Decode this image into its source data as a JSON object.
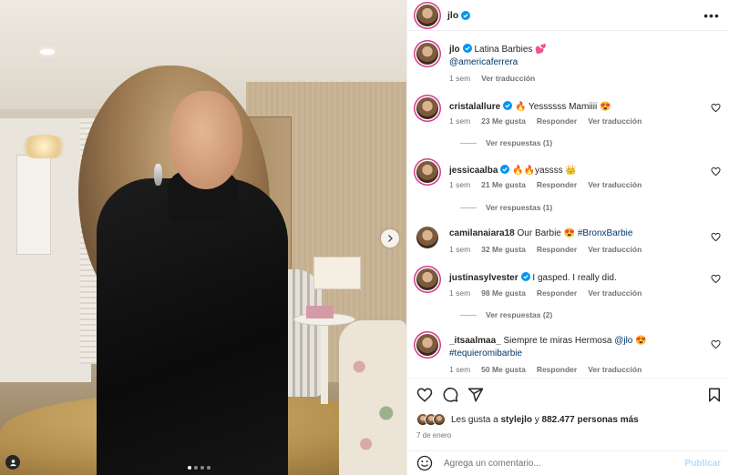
{
  "post": {
    "author": "jlo",
    "caption_text": "Latina Barbies 💕",
    "caption_mention": "@americaferrera",
    "caption_time": "1 sem",
    "caption_translate": "Ver traducción",
    "carousel": {
      "total_slides": 4,
      "current_slide": 1
    }
  },
  "comments": [
    {
      "user": "cristalallure",
      "verified": true,
      "text": "🔥 Yessssss Mamiiii 😍",
      "time": "1 sem",
      "likes": "23 Me gusta",
      "reply": "Responder",
      "translate": "Ver traducción",
      "view_replies": "Ver respuestas (1)"
    },
    {
      "user": "jessicaalba",
      "verified": true,
      "text": "🔥🔥yassss 👑",
      "time": "1 sem",
      "likes": "21 Me gusta",
      "reply": "Responder",
      "translate": "Ver traducción",
      "view_replies": "Ver respuestas (1)"
    },
    {
      "user": "camilanaiara18",
      "verified": false,
      "text": "Our Barbie 😍",
      "hashtag": "#BronxBarbie",
      "time": "1 sem",
      "likes": "32 Me gusta",
      "reply": "Responder",
      "translate": "Ver traducción"
    },
    {
      "user": "justinasylvester",
      "verified": true,
      "text": "I gasped. I really did.",
      "time": "1 sem",
      "likes": "98 Me gusta",
      "reply": "Responder",
      "translate": "Ver traducción",
      "view_replies": "Ver respuestas (2)"
    },
    {
      "user": "_itsaalmaa_",
      "verified": false,
      "text": "Siempre te miras Hermosa",
      "mention": "@jlo",
      "emoji": "😍",
      "hashtag": "#tequieromibarbie",
      "time": "1 sem",
      "likes": "50 Me gusta",
      "reply": "Responder",
      "translate": "Ver traducción"
    }
  ],
  "likes": {
    "prefix": "Les gusta a",
    "user": "stylejlo",
    "connector": "y",
    "others": "882.477 personas más"
  },
  "date": "7 de enero",
  "composer": {
    "placeholder": "Agrega un comentario...",
    "publish_label": "Publicar"
  },
  "colors": {
    "link": "#00376b",
    "verified": "#0095f6",
    "secondary_text": "#737373",
    "publish_disabled": "#b3dbff",
    "story_ring": "#d63a8a"
  },
  "icons": [
    "more-options-icon",
    "verified-badge-icon",
    "heart-icon",
    "comment-icon",
    "share-icon",
    "save-icon",
    "emoji-icon",
    "next-slide-icon",
    "tagged-user-icon"
  ]
}
